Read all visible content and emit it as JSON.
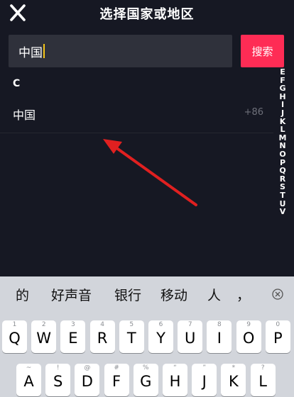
{
  "header": {
    "title": "选择国家或地区",
    "close_icon": "close-icon"
  },
  "search": {
    "value": "中国",
    "button_label": "搜索"
  },
  "list": {
    "section_header": "C",
    "rows": [
      {
        "name": "中国",
        "code": "+86"
      }
    ]
  },
  "alpha_index": [
    "E",
    "F",
    "G",
    "H",
    "I",
    "J",
    "K",
    "L",
    "M",
    "N",
    "O",
    "P",
    "Q",
    "R",
    "S",
    "T",
    "U",
    "V"
  ],
  "annotation": {
    "arrow_color": "#e02020"
  },
  "suggestions": [
    "的",
    "好声音",
    "银行",
    "移动",
    "人",
    "，"
  ],
  "keyboard": {
    "row1": [
      {
        "key": "Q",
        "sub": "1"
      },
      {
        "key": "W",
        "sub": "2"
      },
      {
        "key": "E",
        "sub": "3"
      },
      {
        "key": "R",
        "sub": "4"
      },
      {
        "key": "T",
        "sub": "5"
      },
      {
        "key": "Y",
        "sub": "6"
      },
      {
        "key": "U",
        "sub": "7"
      },
      {
        "key": "I",
        "sub": "8"
      },
      {
        "key": "O",
        "sub": "9"
      },
      {
        "key": "P",
        "sub": "0"
      }
    ],
    "row2": [
      {
        "key": "A",
        "sub": "~"
      },
      {
        "key": "S",
        "sub": "!"
      },
      {
        "key": "D",
        "sub": "@"
      },
      {
        "key": "F",
        "sub": "#"
      },
      {
        "key": "G",
        "sub": "%"
      },
      {
        "key": "H",
        "sub": "“"
      },
      {
        "key": "J",
        "sub": "”"
      },
      {
        "key": "K",
        "sub": "*"
      },
      {
        "key": "L",
        "sub": "?"
      }
    ]
  },
  "colors": {
    "background": "#161823",
    "accent": "#fe2c55",
    "caret": "#f5c518"
  }
}
